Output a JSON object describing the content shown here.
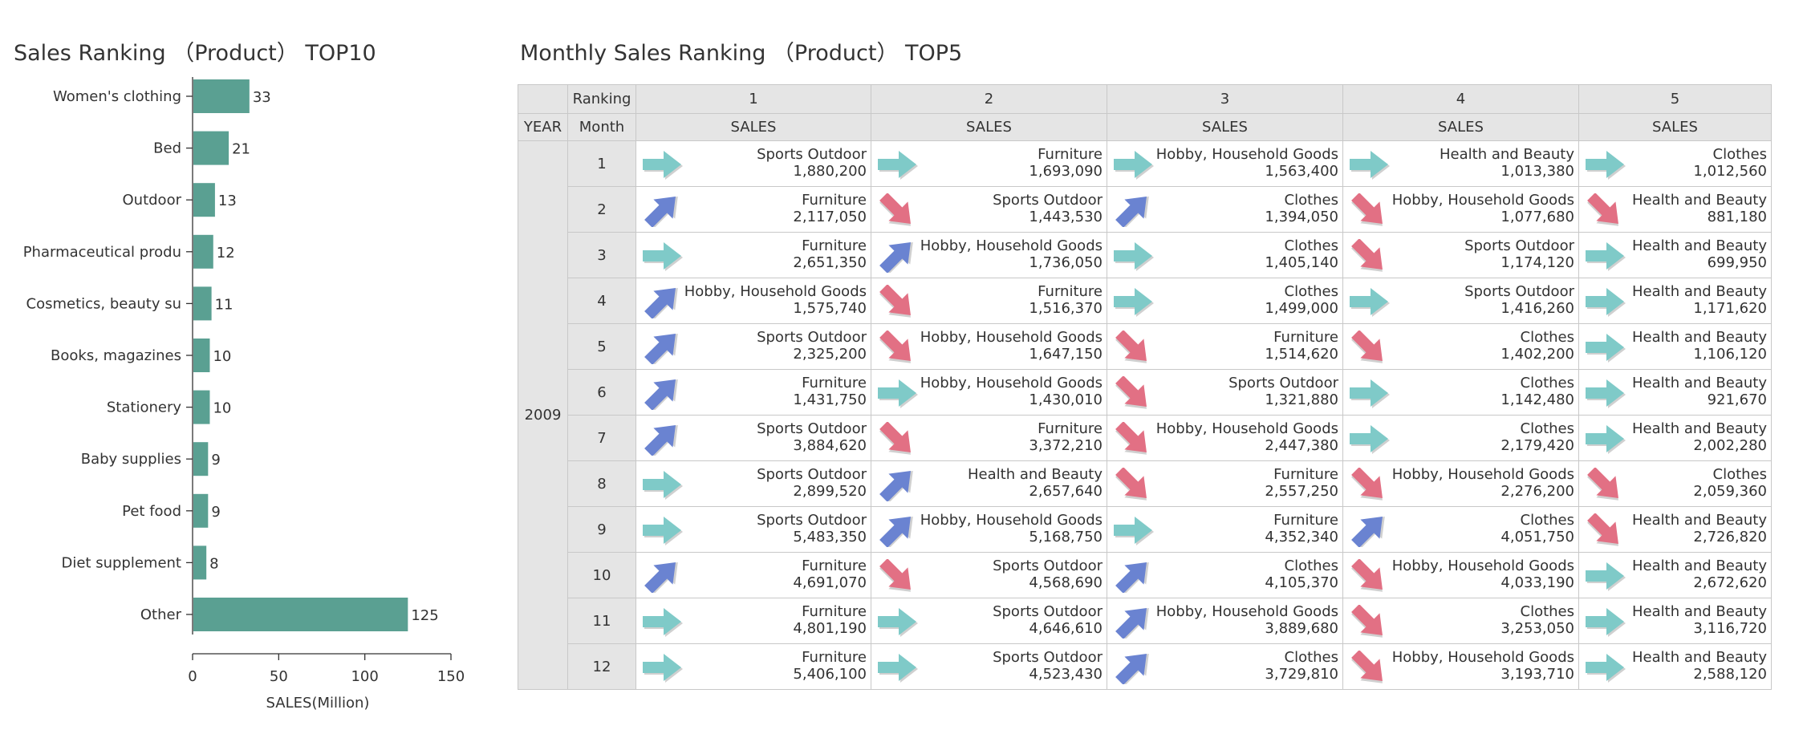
{
  "colors": {
    "bar": "#5aa092",
    "arrow_up": "#6a83d1",
    "arrow_flat": "#7fcac8",
    "arrow_down": "#e27084",
    "header_bg": "#e5e5e5",
    "grid": "#c8c8c8"
  },
  "left_panel": {
    "title": "Sales Ranking （Product） TOP10"
  },
  "right_panel": {
    "title": "Monthly Sales Ranking （Product） TOP5",
    "header": {
      "ranking_label": "Ranking",
      "year_label": "YEAR",
      "month_label": "Month",
      "ranks": [
        "1",
        "2",
        "3",
        "4",
        "5"
      ],
      "sales_label": "SALES"
    },
    "year": "2009",
    "rows": [
      {
        "month": "1",
        "cells": [
          {
            "name": "Sports Outdoor",
            "value": "1,880,200",
            "trend": "flat"
          },
          {
            "name": "Furniture",
            "value": "1,693,090",
            "trend": "flat"
          },
          {
            "name": "Hobby, Household Goods",
            "value": "1,563,400",
            "trend": "flat"
          },
          {
            "name": "Health and Beauty",
            "value": "1,013,380",
            "trend": "flat"
          },
          {
            "name": "Clothes",
            "value": "1,012,560",
            "trend": "flat"
          }
        ]
      },
      {
        "month": "2",
        "cells": [
          {
            "name": "Furniture",
            "value": "2,117,050",
            "trend": "up"
          },
          {
            "name": "Sports Outdoor",
            "value": "1,443,530",
            "trend": "down"
          },
          {
            "name": "Clothes",
            "value": "1,394,050",
            "trend": "up"
          },
          {
            "name": "Hobby, Household Goods",
            "value": "1,077,680",
            "trend": "down"
          },
          {
            "name": "Health and Beauty",
            "value": "881,180",
            "trend": "down"
          }
        ]
      },
      {
        "month": "3",
        "cells": [
          {
            "name": "Furniture",
            "value": "2,651,350",
            "trend": "flat"
          },
          {
            "name": "Hobby, Household Goods",
            "value": "1,736,050",
            "trend": "up"
          },
          {
            "name": "Clothes",
            "value": "1,405,140",
            "trend": "flat"
          },
          {
            "name": "Sports Outdoor",
            "value": "1,174,120",
            "trend": "down"
          },
          {
            "name": "Health and Beauty",
            "value": "699,950",
            "trend": "flat"
          }
        ]
      },
      {
        "month": "4",
        "cells": [
          {
            "name": "Hobby, Household Goods",
            "value": "1,575,740",
            "trend": "up"
          },
          {
            "name": "Furniture",
            "value": "1,516,370",
            "trend": "down"
          },
          {
            "name": "Clothes",
            "value": "1,499,000",
            "trend": "flat"
          },
          {
            "name": "Sports Outdoor",
            "value": "1,416,260",
            "trend": "flat"
          },
          {
            "name": "Health and Beauty",
            "value": "1,171,620",
            "trend": "flat"
          }
        ]
      },
      {
        "month": "5",
        "cells": [
          {
            "name": "Sports Outdoor",
            "value": "2,325,200",
            "trend": "up"
          },
          {
            "name": "Hobby, Household Goods",
            "value": "1,647,150",
            "trend": "down"
          },
          {
            "name": "Furniture",
            "value": "1,514,620",
            "trend": "down"
          },
          {
            "name": "Clothes",
            "value": "1,402,200",
            "trend": "down"
          },
          {
            "name": "Health and Beauty",
            "value": "1,106,120",
            "trend": "flat"
          }
        ]
      },
      {
        "month": "6",
        "cells": [
          {
            "name": "Furniture",
            "value": "1,431,750",
            "trend": "up"
          },
          {
            "name": "Hobby, Household Goods",
            "value": "1,430,010",
            "trend": "flat"
          },
          {
            "name": "Sports Outdoor",
            "value": "1,321,880",
            "trend": "down"
          },
          {
            "name": "Clothes",
            "value": "1,142,480",
            "trend": "flat"
          },
          {
            "name": "Health and Beauty",
            "value": "921,670",
            "trend": "flat"
          }
        ]
      },
      {
        "month": "7",
        "cells": [
          {
            "name": "Sports Outdoor",
            "value": "3,884,620",
            "trend": "up"
          },
          {
            "name": "Furniture",
            "value": "3,372,210",
            "trend": "down"
          },
          {
            "name": "Hobby, Household Goods",
            "value": "2,447,380",
            "trend": "down"
          },
          {
            "name": "Clothes",
            "value": "2,179,420",
            "trend": "flat"
          },
          {
            "name": "Health and Beauty",
            "value": "2,002,280",
            "trend": "flat"
          }
        ]
      },
      {
        "month": "8",
        "cells": [
          {
            "name": "Sports Outdoor",
            "value": "2,899,520",
            "trend": "flat"
          },
          {
            "name": "Health and Beauty",
            "value": "2,657,640",
            "trend": "up"
          },
          {
            "name": "Furniture",
            "value": "2,557,250",
            "trend": "down"
          },
          {
            "name": "Hobby, Household Goods",
            "value": "2,276,200",
            "trend": "down"
          },
          {
            "name": "Clothes",
            "value": "2,059,360",
            "trend": "down"
          }
        ]
      },
      {
        "month": "9",
        "cells": [
          {
            "name": "Sports Outdoor",
            "value": "5,483,350",
            "trend": "flat"
          },
          {
            "name": "Hobby, Household Goods",
            "value": "5,168,750",
            "trend": "up"
          },
          {
            "name": "Furniture",
            "value": "4,352,340",
            "trend": "flat"
          },
          {
            "name": "Clothes",
            "value": "4,051,750",
            "trend": "up"
          },
          {
            "name": "Health and Beauty",
            "value": "2,726,820",
            "trend": "down"
          }
        ]
      },
      {
        "month": "10",
        "cells": [
          {
            "name": "Furniture",
            "value": "4,691,070",
            "trend": "up"
          },
          {
            "name": "Sports Outdoor",
            "value": "4,568,690",
            "trend": "down"
          },
          {
            "name": "Clothes",
            "value": "4,105,370",
            "trend": "up"
          },
          {
            "name": "Hobby, Household Goods",
            "value": "4,033,190",
            "trend": "down"
          },
          {
            "name": "Health and Beauty",
            "value": "2,672,620",
            "trend": "flat"
          }
        ]
      },
      {
        "month": "11",
        "cells": [
          {
            "name": "Furniture",
            "value": "4,801,190",
            "trend": "flat"
          },
          {
            "name": "Sports Outdoor",
            "value": "4,646,610",
            "trend": "flat"
          },
          {
            "name": "Hobby, Household Goods",
            "value": "3,889,680",
            "trend": "up"
          },
          {
            "name": "Clothes",
            "value": "3,253,050",
            "trend": "down"
          },
          {
            "name": "Health and Beauty",
            "value": "3,116,720",
            "trend": "flat"
          }
        ]
      },
      {
        "month": "12",
        "cells": [
          {
            "name": "Furniture",
            "value": "5,406,100",
            "trend": "flat"
          },
          {
            "name": "Sports Outdoor",
            "value": "4,523,430",
            "trend": "flat"
          },
          {
            "name": "Clothes",
            "value": "3,729,810",
            "trend": "up"
          },
          {
            "name": "Hobby, Household Goods",
            "value": "3,193,710",
            "trend": "down"
          },
          {
            "name": "Health and Beauty",
            "value": "2,588,120",
            "trend": "flat"
          }
        ]
      }
    ]
  },
  "chart_data": {
    "type": "bar",
    "orientation": "horizontal",
    "title": "Sales Ranking （Product） TOP10",
    "categories": [
      "Women's clothing",
      "Bed",
      "Outdoor",
      "Pharmaceutical produ",
      "Cosmetics, beauty su",
      "Books, magazines",
      "Stationery",
      "Baby supplies",
      "Pet food",
      "Diet supplement",
      "Other"
    ],
    "values": [
      33,
      21,
      13,
      12,
      11,
      10,
      10,
      9,
      9,
      8,
      125
    ],
    "xlabel": "SALES(Million)",
    "ylabel": "",
    "xlim": [
      0,
      150
    ],
    "xticks": [
      0,
      50,
      100,
      150
    ],
    "grid": false,
    "data_labels": true
  }
}
